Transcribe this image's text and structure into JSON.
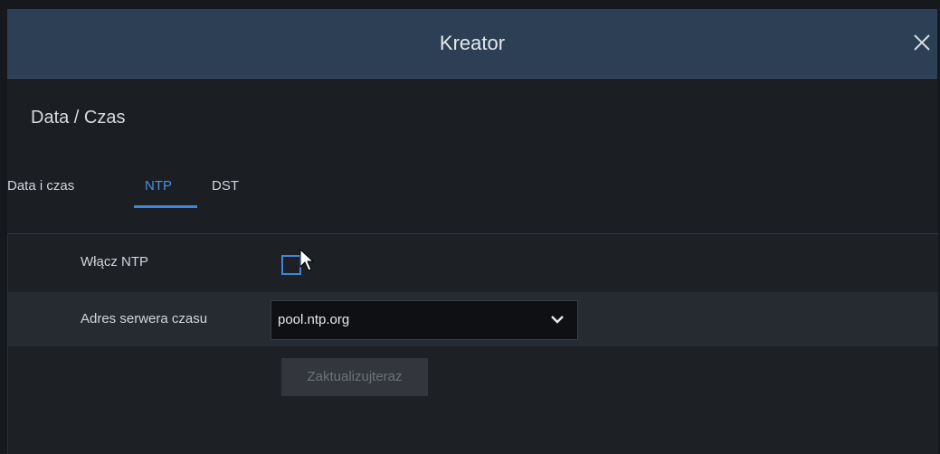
{
  "window": {
    "title": "Kreator",
    "close_icon": "close-icon"
  },
  "section": {
    "title": "Data / Czas"
  },
  "tabs": [
    {
      "label": "Data i czas",
      "active": false
    },
    {
      "label": "NTP",
      "active": true
    },
    {
      "label": "DST",
      "active": false
    }
  ],
  "ntp": {
    "enable_label": "Włącz NTP",
    "enable_checked": false,
    "server_label": "Adres serwera czasu",
    "server_value": "pool.ntp.org",
    "update_button": "Zaktualizujteraz"
  },
  "colors": {
    "accent": "#3f86d9",
    "titlebar": "#2d3f54",
    "background": "#1b1e23"
  }
}
